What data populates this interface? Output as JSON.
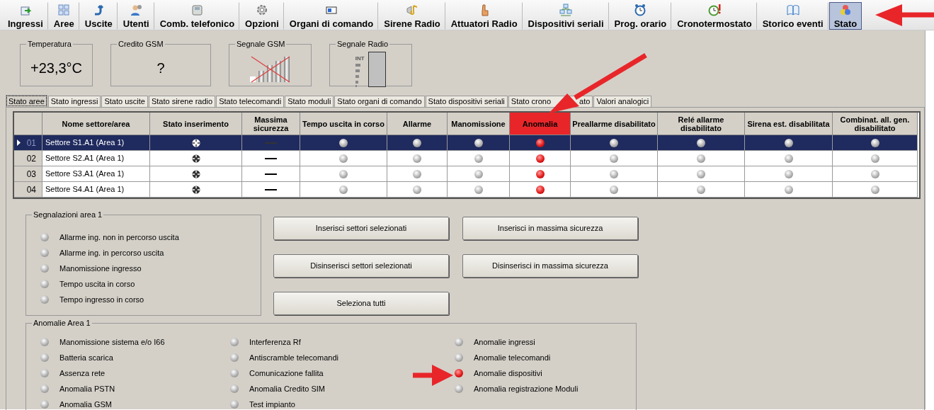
{
  "toolbar": [
    {
      "label": "Ingressi",
      "selected": false
    },
    {
      "label": "Aree",
      "selected": false
    },
    {
      "label": "Uscite",
      "selected": false
    },
    {
      "label": "Utenti",
      "selected": false
    },
    {
      "label": "Comb. telefonico",
      "selected": false
    },
    {
      "label": "Opzioni",
      "selected": false
    },
    {
      "label": "Organi di comando",
      "selected": false
    },
    {
      "label": "Sirene Radio",
      "selected": false
    },
    {
      "label": "Attuatori Radio",
      "selected": false
    },
    {
      "label": "Dispositivi seriali",
      "selected": false
    },
    {
      "label": "Prog. orario",
      "selected": false
    },
    {
      "label": "Cronotermostato",
      "selected": false
    },
    {
      "label": "Storico eventi",
      "selected": false
    },
    {
      "label": "Stato",
      "selected": true
    }
  ],
  "gauges": [
    {
      "kind": "text",
      "title": "Temperatura",
      "value": "+23,3°C"
    },
    {
      "kind": "text",
      "title": "Credito GSM",
      "value": "?"
    },
    {
      "kind": "gsm",
      "title": "Segnale GSM"
    },
    {
      "kind": "radio",
      "title": "Segnale Radio",
      "label": "INT"
    }
  ],
  "tabs": [
    {
      "label": "Stato aree",
      "selected": true
    },
    {
      "label": "Stato ingressi",
      "selected": false
    },
    {
      "label": "Stato uscite",
      "selected": false
    },
    {
      "label": "Stato sirene radio",
      "selected": false
    },
    {
      "label": "Stato telecomandi",
      "selected": false
    },
    {
      "label": "Stato moduli",
      "selected": false
    },
    {
      "label": "Stato organi di comando",
      "selected": false
    },
    {
      "label": "Stato dispositivi seriali",
      "selected": false
    },
    {
      "label": "Stato crono",
      "label_end": "ato",
      "selected": false
    },
    {
      "label": "Valori analogici",
      "selected": false
    }
  ],
  "table": {
    "columns": [
      {
        "label": "Nome settore/area",
        "highlighted": false
      },
      {
        "label": "Stato inserimento",
        "highlighted": false
      },
      {
        "label": "Massima sicurezza",
        "highlighted": false
      },
      {
        "label": "Tempo uscita in corso",
        "highlighted": false
      },
      {
        "label": "Allarme",
        "highlighted": false
      },
      {
        "label": "Manomissione",
        "highlighted": false
      },
      {
        "label": "Anomalia",
        "highlighted": true
      },
      {
        "label": "Preallarme disabilitato",
        "highlighted": false
      },
      {
        "label": "Relé allarme disabilitato",
        "highlighted": false
      },
      {
        "label": "Sirena est. disabilitata",
        "highlighted": false
      },
      {
        "label": "Combinat. all. gen. disabilitato",
        "highlighted": false
      }
    ],
    "rows": [
      {
        "number": "01",
        "name": "Settore S1.A1 (Area 1)",
        "selected": true,
        "lights": [
          false,
          false,
          false,
          true,
          false,
          false,
          false,
          false
        ]
      },
      {
        "number": "02",
        "name": "Settore S2.A1 (Area 1)",
        "selected": false,
        "lights": [
          false,
          false,
          false,
          true,
          false,
          false,
          false,
          false
        ]
      },
      {
        "number": "03",
        "name": "Settore S3.A1 (Area 1)",
        "selected": false,
        "lights": [
          false,
          false,
          false,
          true,
          false,
          false,
          false,
          false
        ]
      },
      {
        "number": "04",
        "name": "Settore S4.A1 (Area 1)",
        "selected": false,
        "lights": [
          false,
          false,
          false,
          true,
          false,
          false,
          false,
          false
        ]
      }
    ]
  },
  "signals": {
    "title": "Segnalazioni area 1",
    "items": [
      {
        "label": "Allarme ing. non in percorso uscita",
        "on": false
      },
      {
        "label": "Allarme ing. in percorso uscita",
        "on": false
      },
      {
        "label": "Manomissione ingresso",
        "on": false
      },
      {
        "label": "Tempo uscita in corso",
        "on": false
      },
      {
        "label": "Tempo ingresso in corso",
        "on": false
      }
    ]
  },
  "buttons": [
    [
      "Inserisci settori selezionati",
      "Inserisci in massima sicurezza"
    ],
    [
      "Disinserisci settori selezionati",
      "Disinserisci in massima sicurezza"
    ],
    [
      "Seleziona tutti"
    ]
  ],
  "anomalies": {
    "title": "Anomalie Area 1",
    "columns": [
      [
        {
          "label": "Manomissione sistema e/o I66",
          "on": false
        },
        {
          "label": "Batteria scarica",
          "on": false
        },
        {
          "label": "Assenza rete",
          "on": false
        },
        {
          "label": "Anomalia PSTN",
          "on": false
        },
        {
          "label": "Anomalia GSM",
          "on": false
        }
      ],
      [
        {
          "label": "Interferenza Rf",
          "on": false
        },
        {
          "label": "Antiscramble telecomandi",
          "on": false
        },
        {
          "label": "Comunicazione fallita",
          "on": false
        },
        {
          "label": "Anomalia Credito SIM",
          "on": false
        },
        {
          "label": "Test impianto",
          "on": false
        }
      ],
      [
        {
          "label": "Anomalie ingressi",
          "on": false
        },
        {
          "label": "Anomalie telecomandi",
          "on": false
        },
        {
          "label": "Anomalie dispositivi",
          "on": true
        },
        {
          "label": "Anomalia registrazione Moduli",
          "on": false
        }
      ]
    ]
  }
}
